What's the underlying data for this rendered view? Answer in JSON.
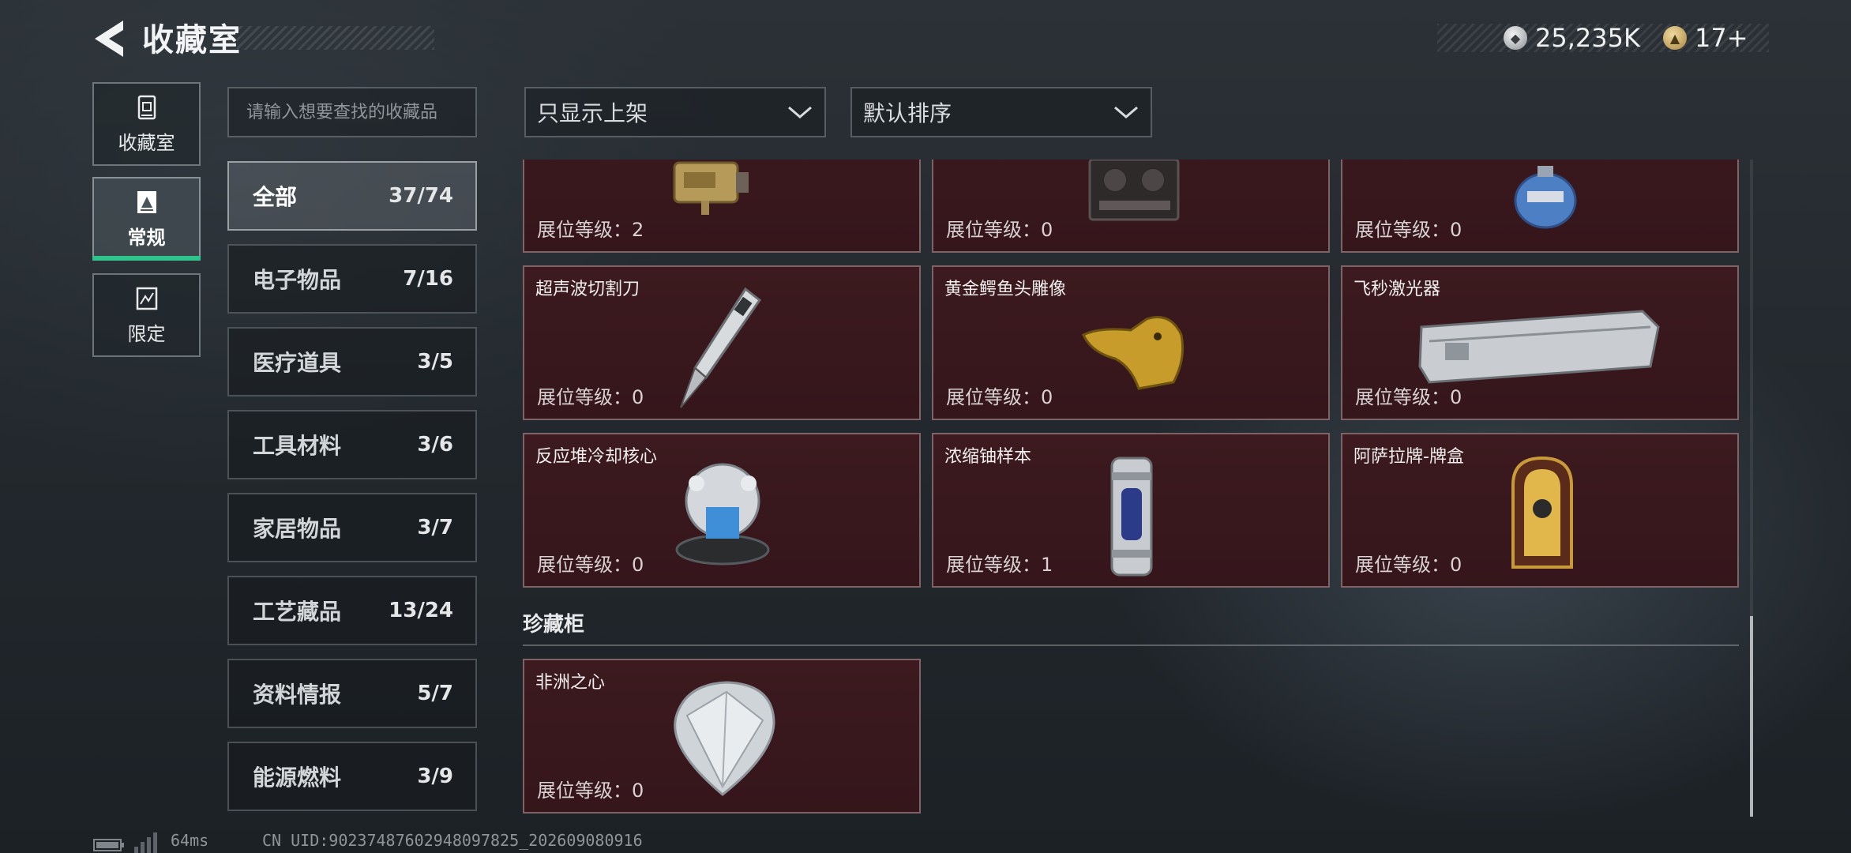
{
  "header": {
    "title": "收藏室",
    "currency_1": "25,235K",
    "currency_2": "17+"
  },
  "nav": {
    "items": [
      {
        "label": "收藏室",
        "icon": "collection-icon"
      },
      {
        "label": "常规",
        "icon": "regular-icon"
      },
      {
        "label": "限定",
        "icon": "limited-icon"
      }
    ],
    "active_index": 1
  },
  "search": {
    "placeholder": "请输入想要查找的收藏品"
  },
  "filters": {
    "display": "只显示上架",
    "sort": "默认排序"
  },
  "categories": [
    {
      "label": "全部",
      "count": "37/74"
    },
    {
      "label": "电子物品",
      "count": "7/16"
    },
    {
      "label": "医疗道具",
      "count": "3/5"
    },
    {
      "label": "工具材料",
      "count": "3/6"
    },
    {
      "label": "家居物品",
      "count": "3/7"
    },
    {
      "label": "工艺藏品",
      "count": "13/24"
    },
    {
      "label": "资料情报",
      "count": "5/7"
    },
    {
      "label": "能源燃料",
      "count": "3/9"
    }
  ],
  "items": [
    {
      "name": "",
      "level": "展位等级：2"
    },
    {
      "name": "",
      "level": "展位等级：0"
    },
    {
      "name": "",
      "level": "展位等级：0"
    },
    {
      "name": "超声波切割刀",
      "level": "展位等级：0"
    },
    {
      "name": "黄金鳄鱼头雕像",
      "level": "展位等级：0"
    },
    {
      "name": "飞秒激光器",
      "level": "展位等级：0"
    },
    {
      "name": "反应堆冷却核心",
      "level": "展位等级：0"
    },
    {
      "name": "浓缩铀样本",
      "level": "展位等级：1"
    },
    {
      "name": "阿萨拉牌-牌盒",
      "level": "展位等级：0"
    }
  ],
  "cabinet": {
    "title": "珍藏柜",
    "items": [
      {
        "name": "非洲之心",
        "level": "展位等级：0"
      }
    ]
  },
  "footer": {
    "latency": "64ms",
    "uid": "CN UID:90237487602948097825_202609080916"
  },
  "colors": {
    "accent_green": "#2ec48b",
    "card_bg": "#3c1a1f",
    "card_border": "#7d6266"
  }
}
